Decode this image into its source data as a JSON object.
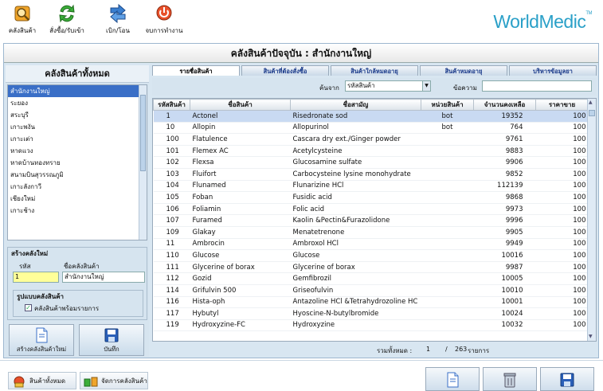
{
  "toolbar": {
    "buttons": [
      {
        "label": "คลังสินค้า",
        "icon": "warehouse-icon"
      },
      {
        "label": "สั่งซื้อ/รับเข้า",
        "icon": "order-receive-icon"
      },
      {
        "label": "เบิก/โอน",
        "icon": "withdraw-transfer-icon"
      },
      {
        "label": "จบการทำงาน",
        "icon": "power-icon"
      }
    ],
    "logo": "WorldMedic",
    "logo_mark": "TM"
  },
  "main_title": "คลังสินค้าปัจจุบัน : สำนักงานใหญ่",
  "left_panel": {
    "title": "คลังสินค้าทั้งหมด",
    "warehouses": [
      "สำนักงานใหญ่",
      "ระยอง",
      "สระบุรี",
      "เกาะพงัน",
      "เกาะเต่า",
      "หาดแวง",
      "หาดบ้านทองทราย",
      "สนามบินสุวรรณภูมิ",
      "เกาะลังกาวี",
      "เชียงใหม่",
      "เกาะช้าง"
    ],
    "create": {
      "title": "สร้างคลังใหม่",
      "code_label": "รหัส",
      "name_label": "ชื่อคลังสินค้า",
      "code_value": "1",
      "name_value": "สำนักงานใหญ่",
      "format_title": "รูปแบบคลังสินค้า",
      "checkbox_label": "คลังสินค้าพร้อมรายการ",
      "checkbox_mark": "✓"
    },
    "buttons": {
      "create": "สร้างคลังสินค้าใหม่",
      "save": "บันทึก"
    }
  },
  "tabs": [
    "รายชื่อสินค้า",
    "สินค้าที่ต้องสั่งซื้อ",
    "สินค้าใกล้หมดอายุ",
    "สินค้าหมดอายุ",
    "บริหารข้อมูลยา"
  ],
  "search": {
    "search_from_label": "ค้นจาก",
    "search_from_value": "รหัสสินค้า",
    "dropdown_arrow": "▼",
    "text_label": "ข้อความ",
    "text_value": ""
  },
  "table": {
    "headers": [
      "รหัสสินค้า",
      "ชื่อสินค้า",
      "ชื่อสามัญ",
      "หน่วยสินค้า",
      "จำนวนคงเหลือ",
      "ราคาขาย"
    ],
    "rows": [
      [
        "1",
        "Actonel",
        "Risedronate sod",
        "bot",
        "19352",
        "100"
      ],
      [
        "10",
        "Allopin",
        "Allopurinol",
        "bot",
        "764",
        "100"
      ],
      [
        "100",
        "Flatulence",
        "Cascara dry ext./Ginger powder",
        "",
        "9761",
        "100"
      ],
      [
        "101",
        "Flemex AC",
        "Acetylcysteine",
        "",
        "9883",
        "100"
      ],
      [
        "102",
        "Flexsa",
        "Glucosamine sulfate",
        "",
        "9906",
        "100"
      ],
      [
        "103",
        "Fluifort",
        "Carbocysteine lysine monohydrate",
        "",
        "9852",
        "100"
      ],
      [
        "104",
        "Flunamed",
        "Flunarizine HCl",
        "",
        "112139",
        "100"
      ],
      [
        "105",
        "Foban",
        "Fusidic acid",
        "",
        "9868",
        "100"
      ],
      [
        "106",
        "Foliamin",
        "Folic acid",
        "",
        "9973",
        "100"
      ],
      [
        "107",
        "Furamed",
        "Kaolin &Pectin&Furazolidone",
        "",
        "9996",
        "100"
      ],
      [
        "109",
        "Glakay",
        "Menatetrenone",
        "",
        "9905",
        "100"
      ],
      [
        "11",
        "Ambrocin",
        "Ambroxol HCl",
        "",
        "9949",
        "100"
      ],
      [
        "110",
        "Glucose",
        "Glucose",
        "",
        "10016",
        "100"
      ],
      [
        "111",
        "Glycerine of borax",
        "Glycerine of borax",
        "",
        "9987",
        "100"
      ],
      [
        "112",
        "Gozid",
        "Gemfibrozil",
        "",
        "10005",
        "100"
      ],
      [
        "114",
        "Grifulvin 500",
        "Griseofulvin",
        "",
        "10010",
        "100"
      ],
      [
        "116",
        "Hista-oph",
        "Antazoline HCl &Tetrahydrozoline HC",
        "",
        "10001",
        "100"
      ],
      [
        "117",
        "Hybutyl",
        "Hyoscine-N-butylbromide",
        "",
        "10024",
        "100"
      ],
      [
        "119",
        "Hydroxyzine-FC",
        "Hydroxyzine",
        "",
        "10032",
        "100"
      ]
    ]
  },
  "totals": {
    "label": "รวมทั้งหมด :",
    "current": "1",
    "separator": "/",
    "total": "263",
    "unit": "รายการ"
  },
  "bottom": {
    "tabs": [
      {
        "label": "สินค้าทั้งหมด",
        "icon": "all-products-icon"
      },
      {
        "label": "จัดการคลังสินค้า",
        "icon": "manage-warehouse-icon"
      }
    ]
  },
  "colors": {
    "accent": "#3a6fc7",
    "panel": "#d6e4ef",
    "highlight": "#ffff99",
    "logo": "#2aa0c8"
  }
}
